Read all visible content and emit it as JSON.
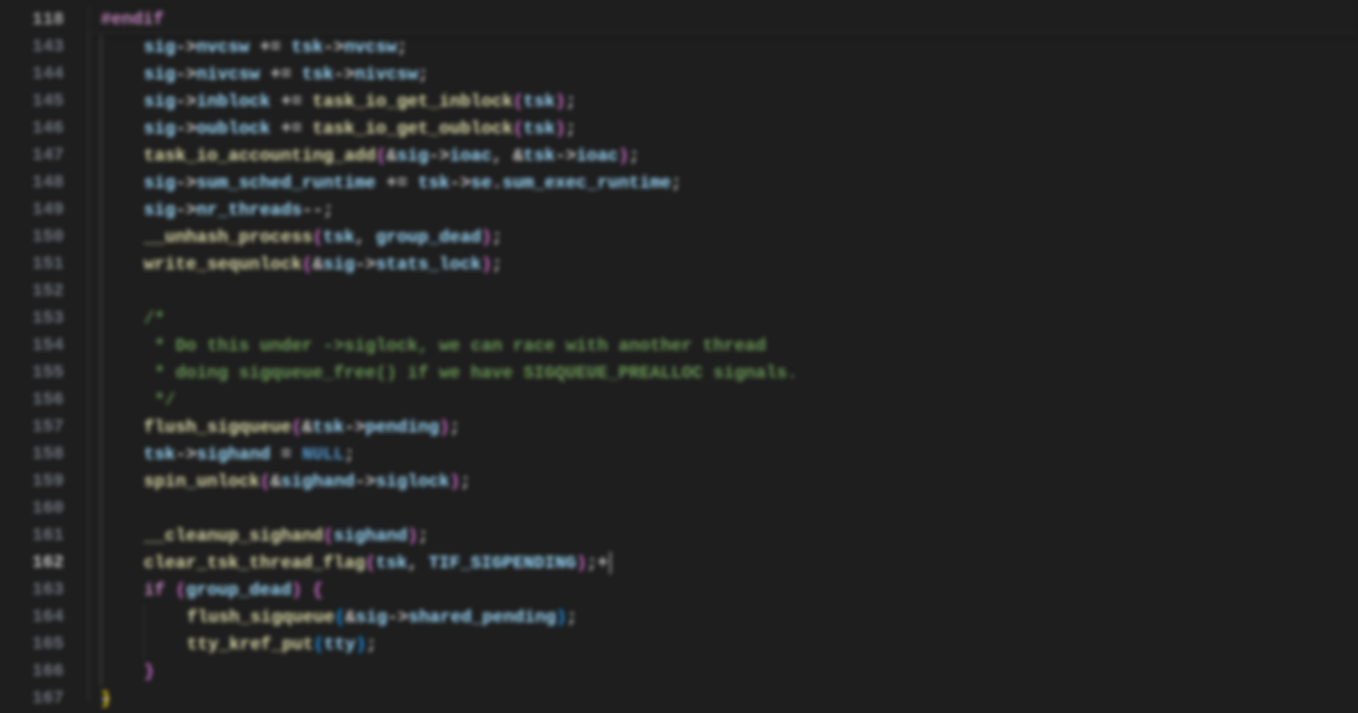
{
  "sticky": {
    "lineNumber": "118",
    "directive": "#endif"
  },
  "lines": [
    {
      "num": "143",
      "indent": 1,
      "tokens": [
        {
          "t": "sig",
          "c": "var"
        },
        {
          "t": "->",
          "c": "op"
        },
        {
          "t": "nvcsw",
          "c": "var"
        },
        {
          "t": " += ",
          "c": "op"
        },
        {
          "t": "tsk",
          "c": "var"
        },
        {
          "t": "->",
          "c": "op"
        },
        {
          "t": "nvcsw",
          "c": "var"
        },
        {
          "t": ";",
          "c": "punc"
        }
      ]
    },
    {
      "num": "144",
      "indent": 1,
      "tokens": [
        {
          "t": "sig",
          "c": "var"
        },
        {
          "t": "->",
          "c": "op"
        },
        {
          "t": "nivcsw",
          "c": "var"
        },
        {
          "t": " += ",
          "c": "op"
        },
        {
          "t": "tsk",
          "c": "var"
        },
        {
          "t": "->",
          "c": "op"
        },
        {
          "t": "nivcsw",
          "c": "var"
        },
        {
          "t": ";",
          "c": "punc"
        }
      ]
    },
    {
      "num": "145",
      "indent": 1,
      "tokens": [
        {
          "t": "sig",
          "c": "var"
        },
        {
          "t": "->",
          "c": "op"
        },
        {
          "t": "inblock",
          "c": "var"
        },
        {
          "t": " += ",
          "c": "op"
        },
        {
          "t": "task_io_get_inblock",
          "c": "func"
        },
        {
          "t": "(",
          "c": "bracket2"
        },
        {
          "t": "tsk",
          "c": "var"
        },
        {
          "t": ")",
          "c": "bracket2"
        },
        {
          "t": ";",
          "c": "punc"
        }
      ]
    },
    {
      "num": "146",
      "indent": 1,
      "tokens": [
        {
          "t": "sig",
          "c": "var"
        },
        {
          "t": "->",
          "c": "op"
        },
        {
          "t": "oublock",
          "c": "var"
        },
        {
          "t": " += ",
          "c": "op"
        },
        {
          "t": "task_io_get_oublock",
          "c": "func"
        },
        {
          "t": "(",
          "c": "bracket2"
        },
        {
          "t": "tsk",
          "c": "var"
        },
        {
          "t": ")",
          "c": "bracket2"
        },
        {
          "t": ";",
          "c": "punc"
        }
      ]
    },
    {
      "num": "147",
      "indent": 1,
      "tokens": [
        {
          "t": "task_io_accounting_add",
          "c": "func"
        },
        {
          "t": "(",
          "c": "bracket2"
        },
        {
          "t": "&",
          "c": "op"
        },
        {
          "t": "sig",
          "c": "var"
        },
        {
          "t": "->",
          "c": "op"
        },
        {
          "t": "ioac",
          "c": "var"
        },
        {
          "t": ", ",
          "c": "punc"
        },
        {
          "t": "&",
          "c": "op"
        },
        {
          "t": "tsk",
          "c": "var"
        },
        {
          "t": "->",
          "c": "op"
        },
        {
          "t": "ioac",
          "c": "var"
        },
        {
          "t": ")",
          "c": "bracket2"
        },
        {
          "t": ";",
          "c": "punc"
        }
      ]
    },
    {
      "num": "148",
      "indent": 1,
      "tokens": [
        {
          "t": "sig",
          "c": "var"
        },
        {
          "t": "->",
          "c": "op"
        },
        {
          "t": "sum_sched_runtime",
          "c": "var"
        },
        {
          "t": " += ",
          "c": "op"
        },
        {
          "t": "tsk",
          "c": "var"
        },
        {
          "t": "->",
          "c": "op"
        },
        {
          "t": "se",
          "c": "var"
        },
        {
          "t": ".",
          "c": "punc"
        },
        {
          "t": "sum_exec_runtime",
          "c": "var"
        },
        {
          "t": ";",
          "c": "punc"
        }
      ]
    },
    {
      "num": "149",
      "indent": 1,
      "tokens": [
        {
          "t": "sig",
          "c": "var"
        },
        {
          "t": "->",
          "c": "op"
        },
        {
          "t": "nr_threads",
          "c": "var"
        },
        {
          "t": "--",
          "c": "op"
        },
        {
          "t": ";",
          "c": "punc"
        }
      ]
    },
    {
      "num": "150",
      "indent": 1,
      "tokens": [
        {
          "t": "__unhash_process",
          "c": "func"
        },
        {
          "t": "(",
          "c": "bracket2"
        },
        {
          "t": "tsk",
          "c": "var"
        },
        {
          "t": ", ",
          "c": "punc"
        },
        {
          "t": "group_dead",
          "c": "var"
        },
        {
          "t": ")",
          "c": "bracket2"
        },
        {
          "t": ";",
          "c": "punc"
        }
      ]
    },
    {
      "num": "151",
      "indent": 1,
      "tokens": [
        {
          "t": "write_sequnlock",
          "c": "func"
        },
        {
          "t": "(",
          "c": "bracket2"
        },
        {
          "t": "&",
          "c": "op"
        },
        {
          "t": "sig",
          "c": "var"
        },
        {
          "t": "->",
          "c": "op"
        },
        {
          "t": "stats_lock",
          "c": "var"
        },
        {
          "t": ")",
          "c": "bracket2"
        },
        {
          "t": ";",
          "c": "punc"
        }
      ]
    },
    {
      "num": "152",
      "indent": 1,
      "tokens": []
    },
    {
      "num": "153",
      "indent": 1,
      "tokens": [
        {
          "t": "/*",
          "c": "comment"
        }
      ]
    },
    {
      "num": "154",
      "indent": 1,
      "tokens": [
        {
          "t": " * Do this under ->siglock, we can race with another thread",
          "c": "comment"
        }
      ]
    },
    {
      "num": "155",
      "indent": 1,
      "tokens": [
        {
          "t": " * doing sigqueue_free() if we have SIGQUEUE_PREALLOC signals.",
          "c": "comment"
        }
      ]
    },
    {
      "num": "156",
      "indent": 1,
      "tokens": [
        {
          "t": " */",
          "c": "comment"
        }
      ]
    },
    {
      "num": "157",
      "indent": 1,
      "tokens": [
        {
          "t": "flush_sigqueue",
          "c": "func"
        },
        {
          "t": "(",
          "c": "bracket2"
        },
        {
          "t": "&",
          "c": "op"
        },
        {
          "t": "tsk",
          "c": "var"
        },
        {
          "t": "->",
          "c": "op"
        },
        {
          "t": "pending",
          "c": "var"
        },
        {
          "t": ")",
          "c": "bracket2"
        },
        {
          "t": ";",
          "c": "punc"
        }
      ]
    },
    {
      "num": "158",
      "indent": 1,
      "tokens": [
        {
          "t": "tsk",
          "c": "var"
        },
        {
          "t": "->",
          "c": "op"
        },
        {
          "t": "sighand",
          "c": "var"
        },
        {
          "t": " = ",
          "c": "op"
        },
        {
          "t": "NULL",
          "c": "const"
        },
        {
          "t": ";",
          "c": "punc"
        }
      ]
    },
    {
      "num": "159",
      "indent": 1,
      "tokens": [
        {
          "t": "spin_unlock",
          "c": "func"
        },
        {
          "t": "(",
          "c": "bracket2"
        },
        {
          "t": "&",
          "c": "op"
        },
        {
          "t": "sighand",
          "c": "var"
        },
        {
          "t": "->",
          "c": "op"
        },
        {
          "t": "siglock",
          "c": "var"
        },
        {
          "t": ")",
          "c": "bracket2"
        },
        {
          "t": ";",
          "c": "punc"
        }
      ]
    },
    {
      "num": "160",
      "indent": 1,
      "tokens": []
    },
    {
      "num": "161",
      "indent": 1,
      "tokens": [
        {
          "t": "__cleanup_sighand",
          "c": "func"
        },
        {
          "t": "(",
          "c": "bracket2"
        },
        {
          "t": "sighand",
          "c": "var"
        },
        {
          "t": ")",
          "c": "bracket2"
        },
        {
          "t": ";",
          "c": "punc"
        }
      ]
    },
    {
      "num": "162",
      "indent": 1,
      "active": true,
      "tokens": [
        {
          "t": "clear_tsk_thread_flag",
          "c": "func"
        },
        {
          "t": "(",
          "c": "bracket2"
        },
        {
          "t": "tsk",
          "c": "var"
        },
        {
          "t": ", ",
          "c": "punc"
        },
        {
          "t": "TIF_SIGPENDING",
          "c": "var"
        },
        {
          "t": ")",
          "c": "bracket2"
        },
        {
          "t": ";+",
          "c": "punc"
        }
      ],
      "cursor": true
    },
    {
      "num": "163",
      "indent": 1,
      "tokens": [
        {
          "t": "if",
          "c": "keyword"
        },
        {
          "t": " ",
          "c": "punc"
        },
        {
          "t": "(",
          "c": "bracket2"
        },
        {
          "t": "group_dead",
          "c": "var"
        },
        {
          "t": ")",
          "c": "bracket2"
        },
        {
          "t": " ",
          "c": "punc"
        },
        {
          "t": "{",
          "c": "bracket2"
        }
      ]
    },
    {
      "num": "164",
      "indent": 2,
      "tokens": [
        {
          "t": "flush_sigqueue",
          "c": "func"
        },
        {
          "t": "(",
          "c": "bracket3"
        },
        {
          "t": "&",
          "c": "op"
        },
        {
          "t": "sig",
          "c": "var"
        },
        {
          "t": "->",
          "c": "op"
        },
        {
          "t": "shared_pending",
          "c": "var"
        },
        {
          "t": ")",
          "c": "bracket3"
        },
        {
          "t": ";",
          "c": "punc"
        }
      ]
    },
    {
      "num": "165",
      "indent": 2,
      "tokens": [
        {
          "t": "tty_kref_put",
          "c": "func"
        },
        {
          "t": "(",
          "c": "bracket3"
        },
        {
          "t": "tty",
          "c": "var"
        },
        {
          "t": ")",
          "c": "bracket3"
        },
        {
          "t": ";",
          "c": "punc"
        }
      ]
    },
    {
      "num": "166",
      "indent": 1,
      "tokens": [
        {
          "t": "}",
          "c": "bracket2"
        }
      ]
    },
    {
      "num": "167",
      "indent": 0,
      "tokens": [
        {
          "t": "}",
          "c": "bracket1"
        }
      ],
      "fold": true
    }
  ]
}
